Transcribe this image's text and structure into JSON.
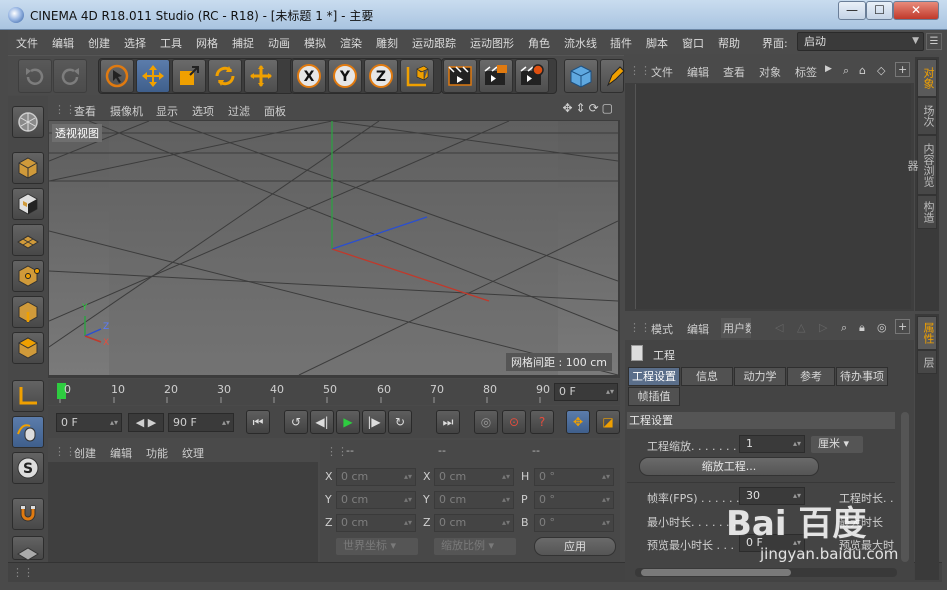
{
  "window": {
    "title": "CINEMA 4D R18.011 Studio (RC - R18) - [未标题 1 *] - 主要",
    "min_glyph": "—",
    "max_glyph": "☐",
    "close_glyph": "✕"
  },
  "menubar": {
    "items": [
      "文件",
      "编辑",
      "创建",
      "选择",
      "工具",
      "网格",
      "捕捉",
      "动画",
      "模拟",
      "渲染",
      "雕刻",
      "运动跟踪",
      "运动图形",
      "角色",
      "流水线",
      "插件",
      "脚本",
      "窗口",
      "帮助"
    ],
    "layout_label": "界面:",
    "layout_value": "启动"
  },
  "toolbar": {
    "icons": [
      "undo-icon",
      "redo-icon",
      "live-select-icon",
      "move-icon",
      "scale-icon",
      "rotate-icon",
      "recent-tool-icon",
      "x-axis-icon",
      "y-axis-icon",
      "z-axis-icon",
      "coordinate-system-icon",
      "render-view-icon",
      "render-picture-viewer-icon",
      "render-settings-icon",
      "cube-icon",
      "pen-icon"
    ],
    "axis_x": "X",
    "axis_y": "Y",
    "axis_z": "Z"
  },
  "viewport": {
    "menu": [
      "查看",
      "摄像机",
      "显示",
      "选项",
      "过滤",
      "面板"
    ],
    "label": "透视视图",
    "grid_spacing": "网格间距 : 100 cm",
    "axis_y_label": "Y",
    "axis_x_label": "X",
    "axis_z_label": "Z"
  },
  "timeline": {
    "ticks": [
      "0",
      "10",
      "20",
      "30",
      "40",
      "50",
      "60",
      "70",
      "80",
      "90"
    ],
    "current_frame": "0 F"
  },
  "playback": {
    "start_field": "0 F",
    "end_field": "90 F",
    "buttons": [
      "go-to-start-icon",
      "previous-key-icon",
      "previous-frame-icon",
      "play-icon",
      "next-frame-icon",
      "next-key-icon",
      "go-to-end-icon"
    ],
    "glyphs": [
      "⏮",
      "↺",
      "◀|",
      "▶",
      "|▶",
      "↻",
      "⏭"
    ]
  },
  "material_manager": {
    "menu": [
      "创建",
      "编辑",
      "功能",
      "纹理"
    ]
  },
  "coordinates": {
    "dash": "--",
    "rows": [
      {
        "l1": "X",
        "v1": "0 cm",
        "l2": "X",
        "v2": "0 cm",
        "l3": "H",
        "v3": "0 °"
      },
      {
        "l1": "Y",
        "v1": "0 cm",
        "l2": "Y",
        "v2": "0 cm",
        "l3": "P",
        "v3": "0 °"
      },
      {
        "l1": "Z",
        "v1": "0 cm",
        "l2": "Z",
        "v2": "0 cm",
        "l3": "B",
        "v3": "0 °"
      }
    ],
    "world_coord": "世界坐标",
    "scale_ratio": "缩放比例",
    "apply": "应用"
  },
  "object_manager": {
    "menu": [
      "文件",
      "编辑",
      "查看",
      "对象",
      "标签"
    ],
    "side_tabs": [
      "对象",
      "场次",
      "内容浏览器",
      "构造"
    ]
  },
  "attribute_manager": {
    "menu": [
      "模式",
      "编辑",
      "用户数据"
    ],
    "title": "工程",
    "tabs": [
      "工程设置",
      "信息",
      "动力学",
      "参考",
      "待办事项",
      "帧插值"
    ],
    "section": "工程设置",
    "project_scale_label": "工程缩放. . . . . . . . .",
    "project_scale_value": "1",
    "project_scale_unit": "厘米",
    "scale_project_button": "缩放工程...",
    "fps_label": "帧率(FPS) . . . . . . .",
    "fps_value": "30",
    "project_time_label": "工程时长. .",
    "min_time_label": "最小时长. . . . . . . .",
    "max_time_label": "最大时长",
    "preview_min_label": "预览最小时长 . . .",
    "preview_min_value": "0 F",
    "preview_max_label": "预览最大时",
    "side_tabs": [
      "属性",
      "层"
    ]
  },
  "watermark": {
    "brand": "Bai 百度",
    "site": "jingyan.baidu.com"
  },
  "colors": {
    "accent_orange": "#f0a000",
    "axis_x": "#c0392b",
    "axis_y": "#2ea043",
    "axis_z": "#2a4fd0",
    "active_tab": "#5a6e8a"
  }
}
